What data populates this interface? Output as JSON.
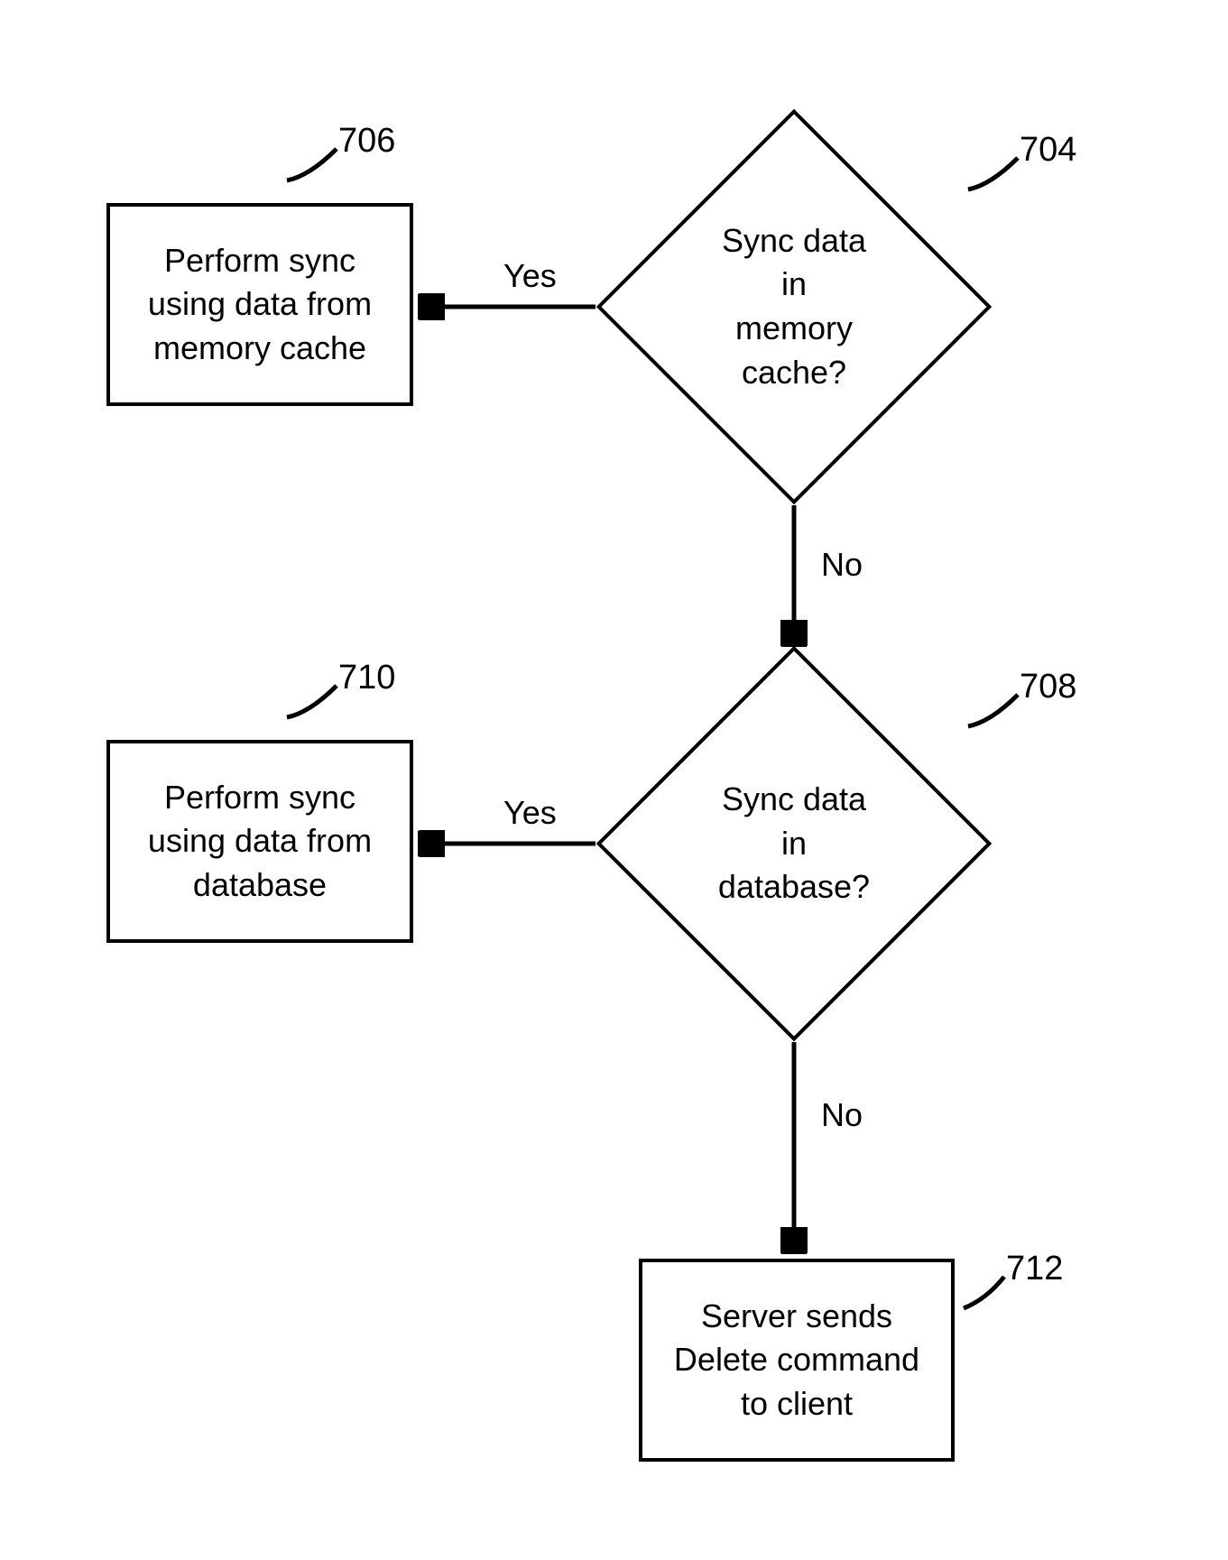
{
  "nodes": {
    "d704": {
      "text": "Sync data in\nmemory cache?",
      "ref": "704"
    },
    "b706": {
      "text": "Perform sync\nusing data from\nmemory cache",
      "ref": "706"
    },
    "d708": {
      "text": "Sync data in\ndatabase?",
      "ref": "708"
    },
    "b710": {
      "text": "Perform sync\nusing data from\ndatabase",
      "ref": "710"
    },
    "b712": {
      "text": "Server sends\nDelete command\nto client",
      "ref": "712"
    }
  },
  "labels": {
    "yes1": "Yes",
    "no1": "No",
    "yes2": "Yes",
    "no2": "No"
  }
}
